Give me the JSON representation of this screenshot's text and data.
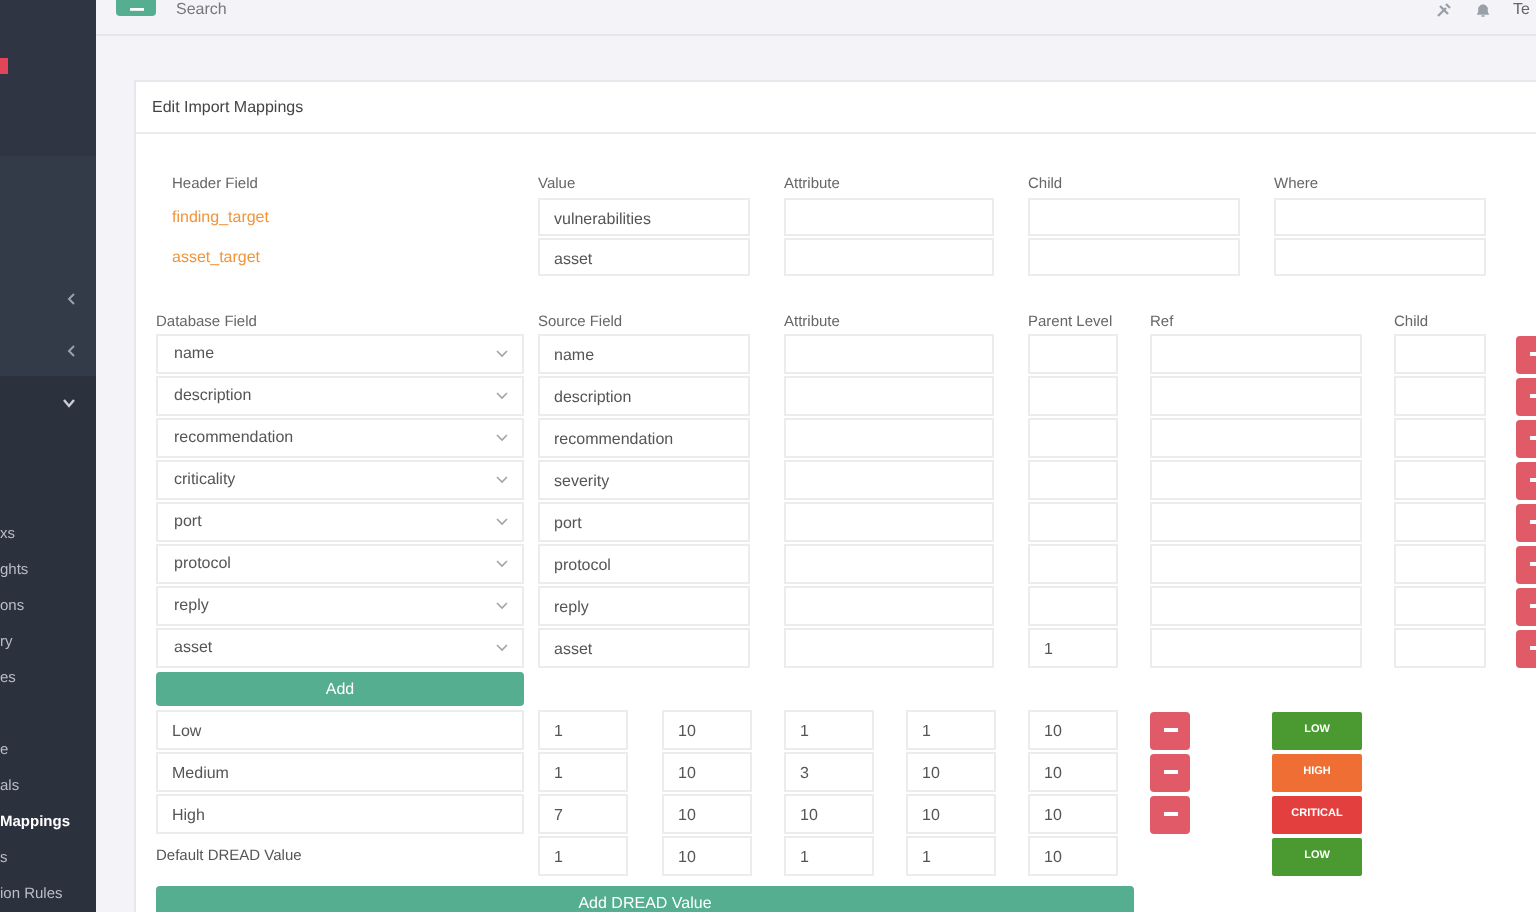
{
  "sidebar": {
    "groups": [
      {
        "expanded": false
      },
      {
        "expanded": false
      },
      {
        "expanded": true
      }
    ],
    "sections": [
      {
        "items": [
          {
            "label": "xs",
            "selected": false
          },
          {
            "label": "ghts",
            "selected": false
          },
          {
            "label": "ons",
            "selected": false
          },
          {
            "label": "ry",
            "selected": false
          },
          {
            "label": "es",
            "selected": false
          }
        ]
      },
      {
        "items": [
          {
            "label": "e",
            "selected": false
          },
          {
            "label": "als",
            "selected": false
          },
          {
            "label": "Mappings",
            "selected": true
          },
          {
            "label": "s",
            "selected": false
          },
          {
            "label": "ion Rules",
            "selected": false
          }
        ]
      }
    ]
  },
  "topbar": {
    "search": {
      "placeholder": "Search"
    },
    "user": "Te"
  },
  "card": {
    "title": "Edit Import Mappings",
    "header_fields": {
      "columns": [
        "Header Field",
        "Value",
        "Attribute",
        "Child",
        "Where"
      ],
      "rows": [
        {
          "field": "finding_target",
          "value": "vulnerabilities"
        },
        {
          "field": "asset_target",
          "value": "asset"
        }
      ]
    },
    "mappings": {
      "columns": [
        "Database Field",
        "Source Field",
        "Attribute",
        "Parent Level",
        "Ref",
        "Child"
      ],
      "rows": [
        {
          "database_field": "name",
          "source_field": "name"
        },
        {
          "database_field": "description",
          "source_field": "description"
        },
        {
          "database_field": "recommendation",
          "source_field": "recommendation"
        },
        {
          "database_field": "criticality",
          "source_field": "severity"
        },
        {
          "database_field": "port",
          "source_field": "port"
        },
        {
          "database_field": "protocol",
          "source_field": "protocol"
        },
        {
          "database_field": "reply",
          "source_field": "reply"
        },
        {
          "database_field": "asset",
          "source_field": "asset",
          "parent_level": "1"
        }
      ],
      "add_button": "Add"
    },
    "dread": {
      "rows": [
        {
          "name": "Low",
          "values": [
            "1",
            "10",
            "1",
            "1",
            "10"
          ],
          "badge": {
            "label": "LOW",
            "kind": "low"
          }
        },
        {
          "name": "Medium",
          "values": [
            "1",
            "10",
            "3",
            "10",
            "10"
          ],
          "badge": {
            "label": "HIGH",
            "kind": "high"
          }
        },
        {
          "name": "High",
          "values": [
            "7",
            "10",
            "10",
            "10",
            "10"
          ],
          "badge": {
            "label": "CRITICAL",
            "kind": "critical"
          }
        }
      ],
      "default": {
        "label": "Default DREAD Value",
        "values": [
          "1",
          "10",
          "1",
          "1",
          "10"
        ],
        "badge": {
          "label": "LOW",
          "kind": "low"
        }
      },
      "add_button": "Add DREAD Value"
    }
  }
}
